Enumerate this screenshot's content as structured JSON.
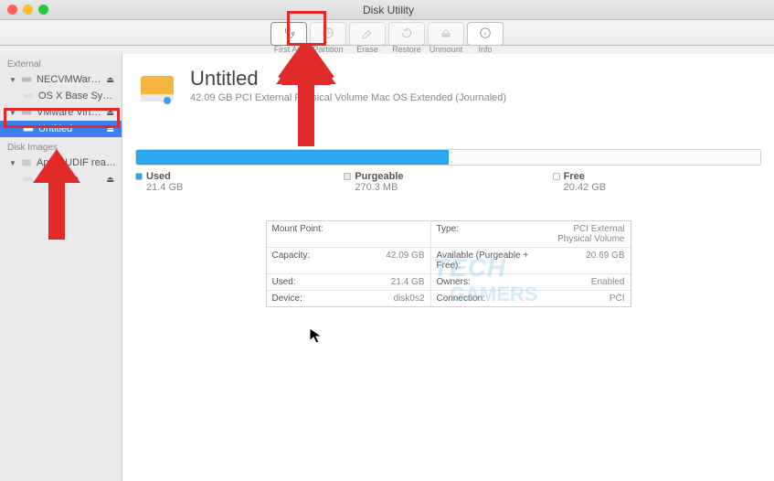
{
  "window": {
    "title": "Disk Utility"
  },
  "toolbar": {
    "first_aid": "First Aid",
    "partition": "Partition",
    "erase": "Erase",
    "restore": "Restore",
    "unmount": "Unmount",
    "info": "Info"
  },
  "sidebar": {
    "external_header": "External",
    "disk_images_header": "Disk Images",
    "items": [
      {
        "name": "NECVMWar VM…",
        "kind": "disk"
      },
      {
        "name": "OS X Base Sy…",
        "kind": "vol"
      },
      {
        "name": "VMware Virtual SA…",
        "kind": "disk"
      },
      {
        "name": "Untitled",
        "kind": "vol",
        "selected": true
      },
      {
        "name": "Apple UDIF read-o…",
        "kind": "dmg"
      },
      {
        "name": "Evernote",
        "kind": "vol"
      }
    ]
  },
  "volume": {
    "name": "Untitled",
    "subtitle": "42.09 GB PCI External Physical Volume Mac OS Extended (Journaled)"
  },
  "usage": {
    "used_label": "Used",
    "used_value": "21.4 GB",
    "purgeable_label": "Purgeable",
    "purgeable_value": "270.3 MB",
    "free_label": "Free",
    "free_value": "20.42 GB",
    "used_pct": 50,
    "purge_pct": 0,
    "free_pct": 50
  },
  "details": {
    "mount_point_l": "Mount Point:",
    "mount_point_v": "",
    "capacity_l": "Capacity:",
    "capacity_v": "42.09 GB",
    "used_l": "Used:",
    "used_v": "21.4 GB",
    "device_l": "Device:",
    "device_v": "disk0s2",
    "type_l": "Type:",
    "type_v": "PCI External Physical Volume",
    "avail_l": "Available (Purgeable + Free):",
    "avail_v": "20.69 GB",
    "owners_l": "Owners:",
    "owners_v": "Enabled",
    "connection_l": "Connection:",
    "connection_v": "PCI"
  },
  "watermark": {
    "line1": "TECH",
    "line2": "GAMERS"
  }
}
